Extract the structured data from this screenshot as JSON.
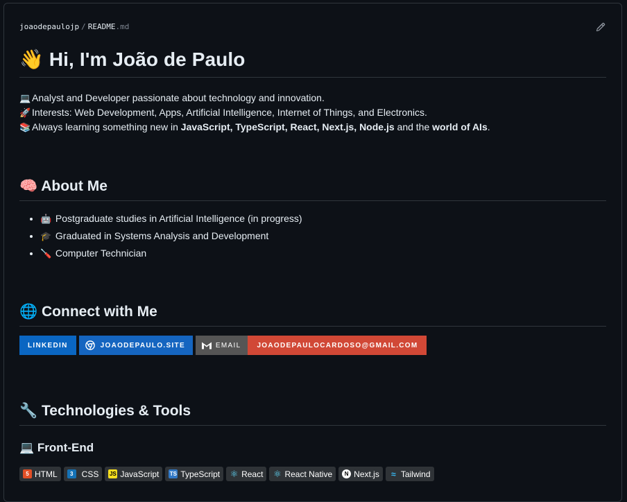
{
  "breadcrumb": {
    "repo": "joaodepaulojp",
    "separator": "/",
    "file_name": "README",
    "file_ext": ".md"
  },
  "toolbar": {
    "edit_icon": "pencil-icon"
  },
  "title": {
    "emoji": "👋",
    "text": "Hi, I'm João de Paulo"
  },
  "intro": {
    "line1": {
      "emoji": "💻",
      "text": "Analyst and Developer passionate about technology and innovation."
    },
    "line2": {
      "emoji": "🚀",
      "text": "Interests: Web Development, Apps, Artificial Intelligence, Internet of Things, and Electronics."
    },
    "line3": {
      "emoji": "📚",
      "prefix": "Always learning something new in ",
      "techs": "JavaScript, TypeScript, React, Next.js, Node.js",
      "mid": " and the ",
      "ais": "world of AIs",
      "suffix": "."
    }
  },
  "about": {
    "emoji": "🧠",
    "heading": "About Me",
    "items": [
      {
        "emoji": "🤖",
        "text": "Postgraduate studies in Artificial Intelligence (in progress)"
      },
      {
        "emoji": "🎓",
        "text": "Graduated in Systems Analysis and Development"
      },
      {
        "emoji": "🪛",
        "text": "Computer Technician"
      }
    ]
  },
  "connect": {
    "emoji": "🌐",
    "heading": "Connect with Me",
    "linkedin": "LINKEDIN",
    "site": "JOAODEPAULO.SITE",
    "email_label": "EMAIL",
    "email_value": "JOAODEPAULOCARDOSO@GMAIL.COM",
    "colors": {
      "linkedin": "#0a66c2",
      "site": "#1565c0",
      "email_label": "#555555",
      "email_value": "#d14836"
    }
  },
  "tech": {
    "emoji": "🔧",
    "heading": "Technologies & Tools",
    "frontend": {
      "emoji": "💻",
      "heading": "Front-End"
    },
    "badges": [
      "HTML",
      "CSS",
      "JavaScript",
      "TypeScript",
      "React",
      "React Native",
      "Next.js",
      "Tailwind"
    ]
  }
}
